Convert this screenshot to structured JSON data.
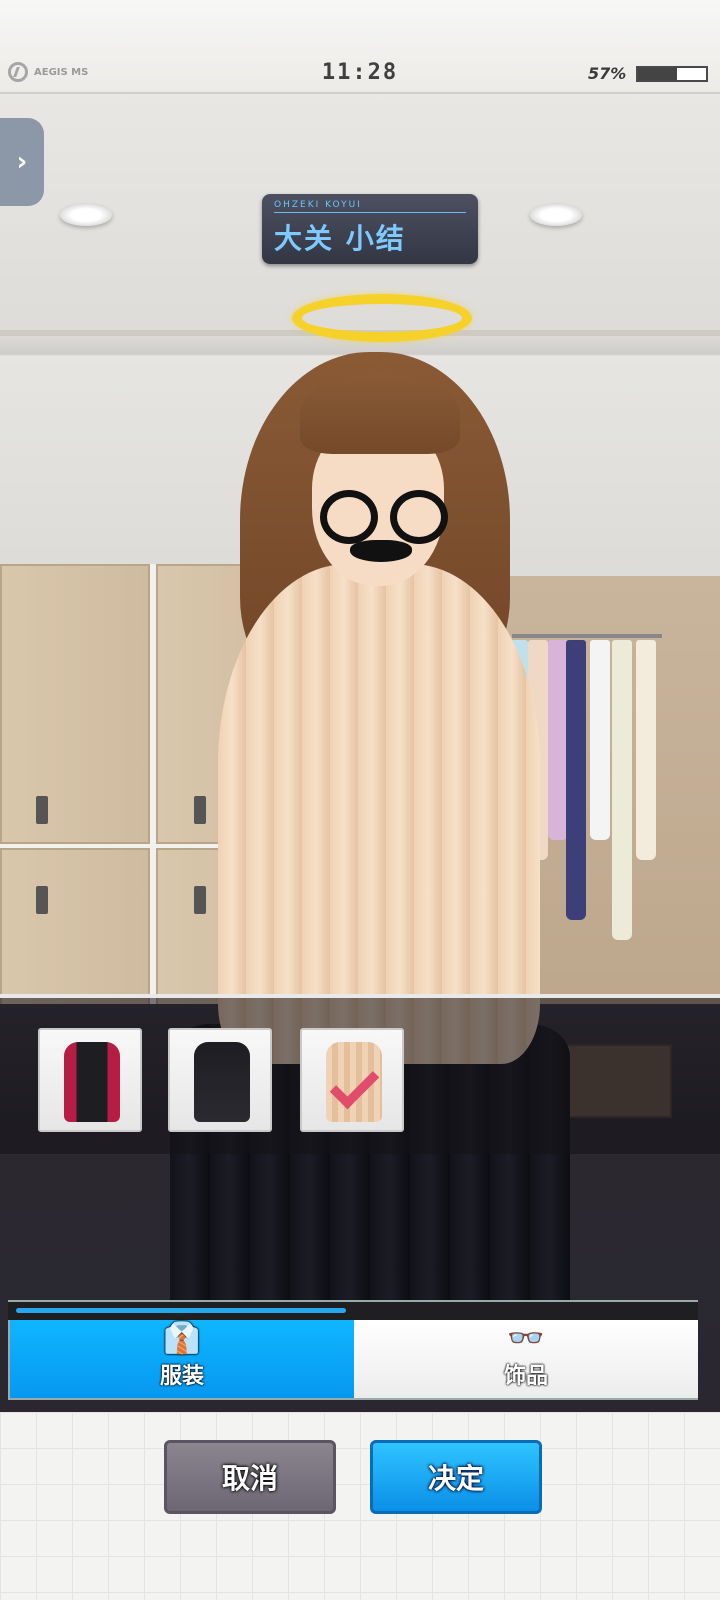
{
  "status_bar": {
    "brand": "AEGIS MS",
    "time": "11:28",
    "battery_text": "57%",
    "battery_level": 0.57
  },
  "character": {
    "name_romaji": "OHZEKI KOYUI",
    "name": "大关 小结"
  },
  "outfits": [
    {
      "icon": "red-black-jacket-outfit-icon",
      "selected": false,
      "color": "#b51d45"
    },
    {
      "icon": "black-suit-outfit-icon",
      "selected": false,
      "color": "#1d1d22"
    },
    {
      "icon": "sweater-outfit-icon",
      "selected": true,
      "color": "#f0d2b4"
    }
  ],
  "tabs": {
    "clothing": {
      "label": "服装",
      "icon": "shirt-icon",
      "active": true
    },
    "accessories": {
      "label": "饰品",
      "icon": "glasses-icon",
      "active": false
    },
    "scroll_progress": 0.49
  },
  "buttons": {
    "cancel": "取消",
    "confirm": "决定"
  },
  "colors": {
    "accent": "#0fb6ff",
    "halo": "#f5d12a",
    "name_text": "#7ec9ff"
  }
}
